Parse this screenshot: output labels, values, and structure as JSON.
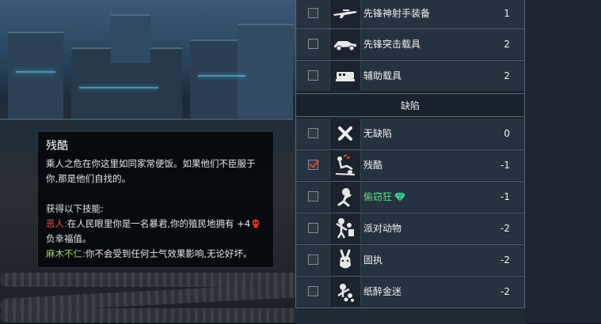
{
  "tooltip": {
    "title": "残酷",
    "description_line1": "乘人之危在你这里如同家常便饭。如果他们不臣服于",
    "description_line2": "你,那是他们自找的。",
    "skills_heading": "获得以下技能:",
    "skill1_name": "恶人:",
    "skill1_text_line1": "在人民眼里你是一名暴君,你的殖民地拥有 +4",
    "skill1_icon": "skull-icon",
    "skill1_text_line2": "负幸福值。",
    "skill2_name": "麻木不仁:",
    "skill2_text": "你不会受到任何士气效果影响,无论好坏。"
  },
  "equipment": [
    {
      "label": "先锋神射手装备",
      "value": "1",
      "icon": "rifle-icon",
      "checked": false
    },
    {
      "label": "先锋突击载具",
      "value": "2",
      "icon": "assault-vehicle-icon",
      "checked": false
    },
    {
      "label": "辅助载具",
      "value": "2",
      "icon": "support-vehicle-icon",
      "checked": false
    }
  ],
  "flaws_header": "缺陷",
  "flaws": [
    {
      "label": "无缺陷",
      "value": "0",
      "icon": "x-mark-icon",
      "checked": false
    },
    {
      "label": "残酷",
      "value": "-1",
      "icon": "cruel-icon",
      "checked": true
    },
    {
      "label": "偷窃狂",
      "value": "-1",
      "icon": "thief-icon",
      "checked": false,
      "badge_icon": "gem-icon"
    },
    {
      "label": "派对动物",
      "value": "-2",
      "icon": "party-icon",
      "checked": false
    },
    {
      "label": "固执",
      "value": "-2",
      "icon": "stubborn-donkey-icon",
      "checked": false
    },
    {
      "label": "纸醉金迷",
      "value": "-2",
      "icon": "luxury-icon",
      "checked": false
    }
  ],
  "colors": {
    "evil_red": "#ff4a3c",
    "callous_green": "#a8d06a",
    "kleptomaniac_green": "#5fe08a",
    "check_red": "#e23a2a"
  }
}
